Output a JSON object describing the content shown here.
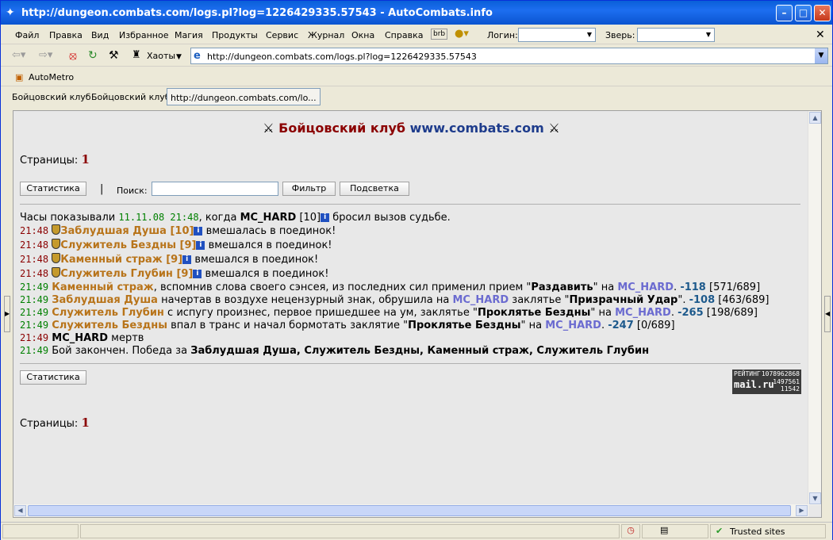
{
  "window": {
    "title": "http://dungeon.combats.com/logs.pl?log=1226429335.57543 - AutoCombats.info"
  },
  "menu": {
    "items": [
      "Файл",
      "Правка",
      "Вид",
      "Избранное",
      "Магия",
      "Продукты",
      "Сервис",
      "Журнал",
      "Окна",
      "Справка"
    ],
    "login_label": "Логин:",
    "pet_label": "Зверь:",
    "brb": "brb"
  },
  "nav": {
    "chaos_label": "Хаоты",
    "address": "http://dungeon.combats.com/logs.pl?log=1226429335.57543"
  },
  "links": {
    "automotro": "AutoMetro"
  },
  "tabs": [
    {
      "label": "Бойцовский клуб"
    },
    {
      "label": "Бойцовский клуб"
    },
    {
      "label": "http://dungeon.combats.com/lo..."
    }
  ],
  "page": {
    "header_red": "Бойцовский клуб",
    "header_blue": "www.combats.com",
    "pages_label": "Страницы:",
    "pages_value": "1",
    "stats_button": "Статистика",
    "separator": "|",
    "search_label": "Поиск:",
    "search_value": "",
    "filter_button": "Фильтр",
    "highlight_button": "Подсветка",
    "rating_title": "РЕЙТИНГ",
    "rating_num1": "1078962868",
    "rating_brand": "mail.ru",
    "rating_num2": "1497561",
    "rating_num3": "11542"
  },
  "log": {
    "intro_prefix": "Часы показывали",
    "intro_time": "11.11.08 21:48",
    "intro_mid": ", когда",
    "intro_player": "MC_HARD",
    "intro_level": "[10]",
    "intro_suffix": "бросил вызов судьбе.",
    "joins": [
      {
        "time": "21:48",
        "name": "Заблудшая Душа [10]",
        "text": "вмешалась в поединок!"
      },
      {
        "time": "21:48",
        "name": "Служитель Бездны [9]",
        "text": "вмешался в поединок!"
      },
      {
        "time": "21:48",
        "name": "Каменный страж [9]",
        "text": "вмешался в поединок!"
      },
      {
        "time": "21:48",
        "name": "Служитель Глубин [9]",
        "text": "вмешался в поединок!"
      }
    ],
    "attacks": [
      {
        "time": "21:49",
        "attacker": "Каменный страж",
        "text1": ", вспомнив слова своего сэнсея, из последних сил применил прием \"",
        "spell": "Раздавить",
        "text2": "\" на",
        "target": "MC_HARD",
        "dmg": "-118",
        "hp": "[571/689]"
      },
      {
        "time": "21:49",
        "attacker": "Заблудшая Душа",
        "text1": " начертав в воздухе нецензурный знак, обрушила на ",
        "target_first": "MC_HARD",
        "text3": " заклятье \"",
        "spell": "Призрачный Удар",
        "text2": "\".",
        "dmg": "-108",
        "hp": "[463/689]"
      },
      {
        "time": "21:49",
        "attacker": "Служитель Глубин",
        "text1": " с испугу произнес, первое пришедшее на ум, заклятье \"",
        "spell": "Проклятье Бездны",
        "text2": "\" на",
        "target": "MC_HARD",
        "dmg": "-265",
        "hp": "[198/689]"
      },
      {
        "time": "21:49",
        "attacker": "Служитель Бездны",
        "text1": " впал в транс и начал бормотать заклятие \"",
        "spell": "Проклятье Бездны",
        "text2": "\" на",
        "target": "MC_HARD",
        "dmg": "-247",
        "hp": "[0/689]"
      }
    ],
    "death_time": "21:49",
    "death_name": "MC_HARD",
    "death_text": "мертв",
    "end_time": "21:49",
    "end_text": "Бой закончен. Победа за",
    "end_winners": "Заблудшая Душа, Служитель Бездны, Каменный страж, Служитель Глубин"
  },
  "status": {
    "trusted": "Trusted sites"
  }
}
